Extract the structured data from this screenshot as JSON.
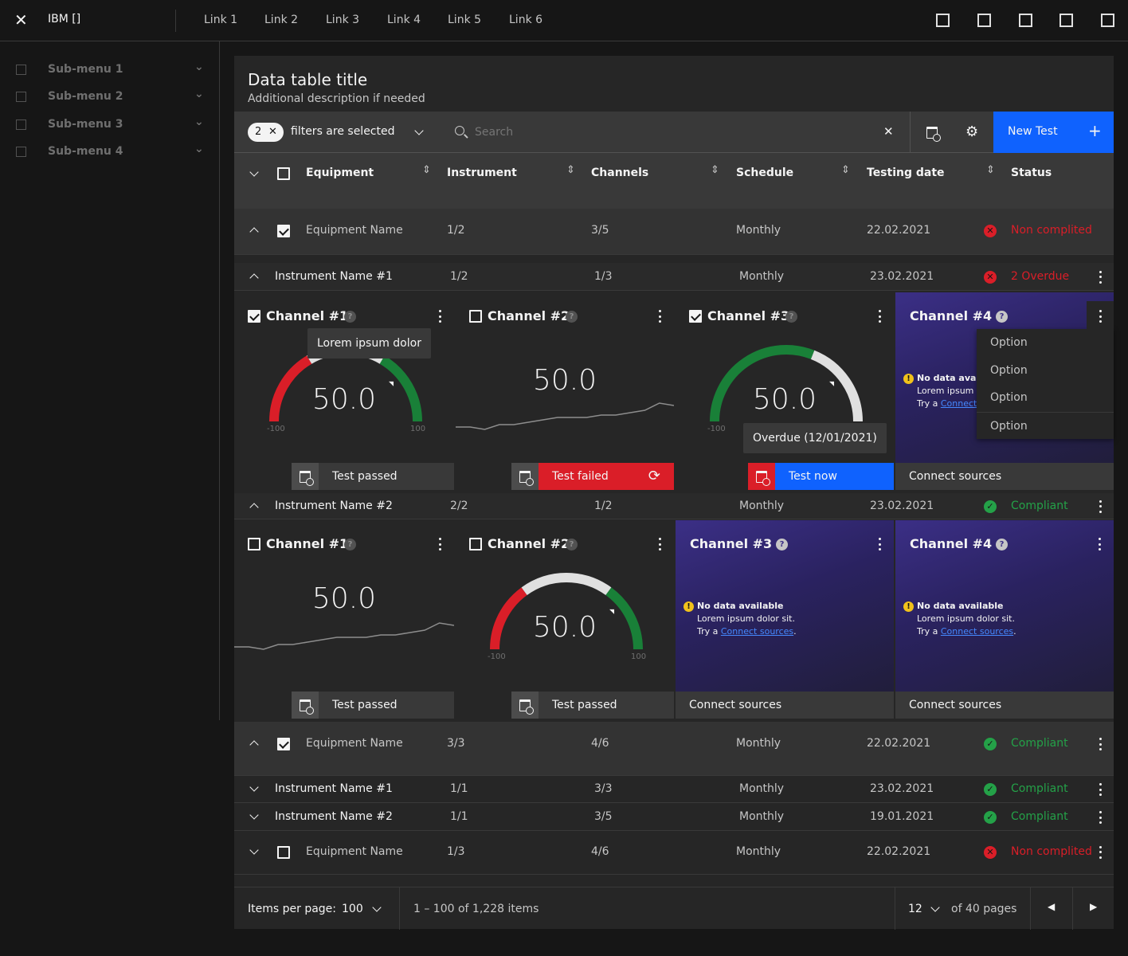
{
  "header": {
    "brand": "IBM []",
    "links": [
      "Link 1",
      "Link 2",
      "Link 3",
      "Link 4",
      "Link 5",
      "Link 6"
    ],
    "action_icons": [
      "square-icon",
      "square-icon",
      "square-icon",
      "square-icon",
      "square-icon"
    ]
  },
  "sidebar": {
    "items": [
      {
        "label": "Sub-menu 1"
      },
      {
        "label": "Sub-menu 2"
      },
      {
        "label": "Sub-menu 3"
      },
      {
        "label": "Sub-menu 4"
      }
    ]
  },
  "table": {
    "title": "Data table title",
    "description": "Additional description if needed",
    "filter": {
      "count": "2",
      "label": "filters are selected"
    },
    "search": {
      "placeholder": "Search"
    },
    "new_button": "New Test",
    "columns": [
      "Equipment",
      "Instrument",
      "Channels",
      "Schedule",
      "Testing date",
      "Status"
    ],
    "rows": [
      {
        "type": "equipment",
        "expanded": true,
        "checked": true,
        "name": "Equipment Name",
        "instrument": "1/2",
        "channels": "3/5",
        "schedule": "Monthly",
        "date": "22.02.2021",
        "status": "Non complited",
        "status_kind": "error"
      },
      {
        "type": "instrument",
        "expanded": true,
        "name": "Instrument Name #1",
        "instrument": "1/2",
        "channels": "1/3",
        "schedule": "Monthly",
        "date": "23.02.2021",
        "status": "2 Overdue",
        "status_kind": "error"
      },
      {
        "type": "instrument",
        "expanded": true,
        "name": "Instrument Name #2",
        "instrument": "2/2",
        "channels": "1/2",
        "schedule": "Monthly",
        "date": "23.02.2021",
        "status": "Compliant",
        "status_kind": "ok"
      },
      {
        "type": "equipment",
        "expanded": true,
        "checked": true,
        "name": "Equipment Name",
        "instrument": "3/3",
        "channels": "4/6",
        "schedule": "Monthly",
        "date": "22.02.2021",
        "status": "Compliant",
        "status_kind": "ok"
      },
      {
        "type": "instrument",
        "expanded": false,
        "name": "Instrument Name #1",
        "instrument": "1/1",
        "channels": "3/3",
        "schedule": "Monthly",
        "date": "23.02.2021",
        "status": "Compliant",
        "status_kind": "ok"
      },
      {
        "type": "instrument",
        "expanded": false,
        "name": "Instrument Name #2",
        "instrument": "1/1",
        "channels": "3/5",
        "schedule": "Monthly",
        "date": "19.01.2021",
        "status": "Compliant",
        "status_kind": "ok"
      },
      {
        "type": "equipment",
        "expanded": false,
        "checked": false,
        "name": "Equipment Name",
        "instrument": "1/3",
        "channels": "4/6",
        "schedule": "Monthly",
        "date": "22.02.2021",
        "status": "Non complited",
        "status_kind": "error"
      }
    ],
    "card_groups": [
      [
        {
          "title": "Channel #1",
          "checked": true,
          "kind": "gauge",
          "value": "50.0",
          "min": "-100",
          "max": "100",
          "segments": [
            [
              "#da1e28",
              0,
              0.33
            ],
            [
              "#e0e0e0",
              0.33,
              0.67
            ],
            [
              "#198038",
              0.67,
              1
            ]
          ],
          "footer": "Test passed",
          "footer_kind": "passed",
          "tooltip": "Lorem ipsum dolor"
        },
        {
          "title": "Channel #2",
          "checked": false,
          "kind": "sparkline",
          "value": "50.0",
          "sparkline": [
            10,
            10,
            9,
            11,
            11,
            12,
            13,
            14,
            14,
            14,
            15,
            15,
            16,
            17,
            20,
            19
          ],
          "footer": "Test failed",
          "footer_kind": "failed"
        },
        {
          "title": "Channel #3",
          "checked": true,
          "kind": "gauge",
          "value": "50.0",
          "min": "-100",
          "max": "100",
          "segments": [
            [
              "#198038",
              0,
              0.62
            ],
            [
              "#e0e0e0",
              0.62,
              1
            ]
          ],
          "footer": "Test now",
          "footer_kind": "now",
          "tooltip": "Overdue (12/01/2021)"
        },
        {
          "title": "Channel #4",
          "kind": "nodata",
          "nodata_title": "No data available",
          "nodata_text": "Lorem ipsum dolor sit.",
          "nodata_try": "Try a",
          "nodata_link": "Connect sources",
          "footer": "Connect sources",
          "footer_kind": "connect",
          "menu": [
            "Option",
            "Option",
            "Option",
            "Option"
          ]
        }
      ],
      [
        {
          "title": "Channel #1",
          "checked": false,
          "kind": "sparkline",
          "value": "50.0",
          "sparkline": [
            10,
            10,
            9,
            11,
            11,
            12,
            13,
            14,
            14,
            14,
            15,
            15,
            16,
            17,
            20,
            19
          ],
          "footer": "Test passed",
          "footer_kind": "passed"
        },
        {
          "title": "Channel #2",
          "checked": false,
          "kind": "gauge",
          "value": "50.0",
          "min": "-100",
          "max": "100",
          "segments": [
            [
              "#da1e28",
              0,
              0.3
            ],
            [
              "#e0e0e0",
              0.3,
              0.7
            ],
            [
              "#198038",
              0.7,
              1
            ]
          ],
          "footer": "Test passed",
          "footer_kind": "passed"
        },
        {
          "title": "Channel #3",
          "kind": "nodata",
          "nodata_title": "No data available",
          "nodata_text": "Lorem ipsum dolor sit.",
          "nodata_try": "Try a",
          "nodata_link": "Connect sources",
          "footer": "Connect sources",
          "footer_kind": "connect"
        },
        {
          "title": "Channel #4",
          "kind": "nodata",
          "nodata_title": "No data available",
          "nodata_text": "Lorem ipsum dolor sit.",
          "nodata_try": "Try a",
          "nodata_link": "Connect sources",
          "footer": "Connect sources",
          "footer_kind": "connect"
        }
      ]
    ],
    "pagination": {
      "items_per_page_label": "Items per page:",
      "items_per_page": "100",
      "range": "1 – 100 of 1,228 items",
      "page": "12",
      "of_pages": "of 40 pages"
    }
  },
  "colors": {
    "error": "#da1e28",
    "ok": "#24a148",
    "primary": "#0f62fe",
    "warning": "#f1c21b"
  }
}
